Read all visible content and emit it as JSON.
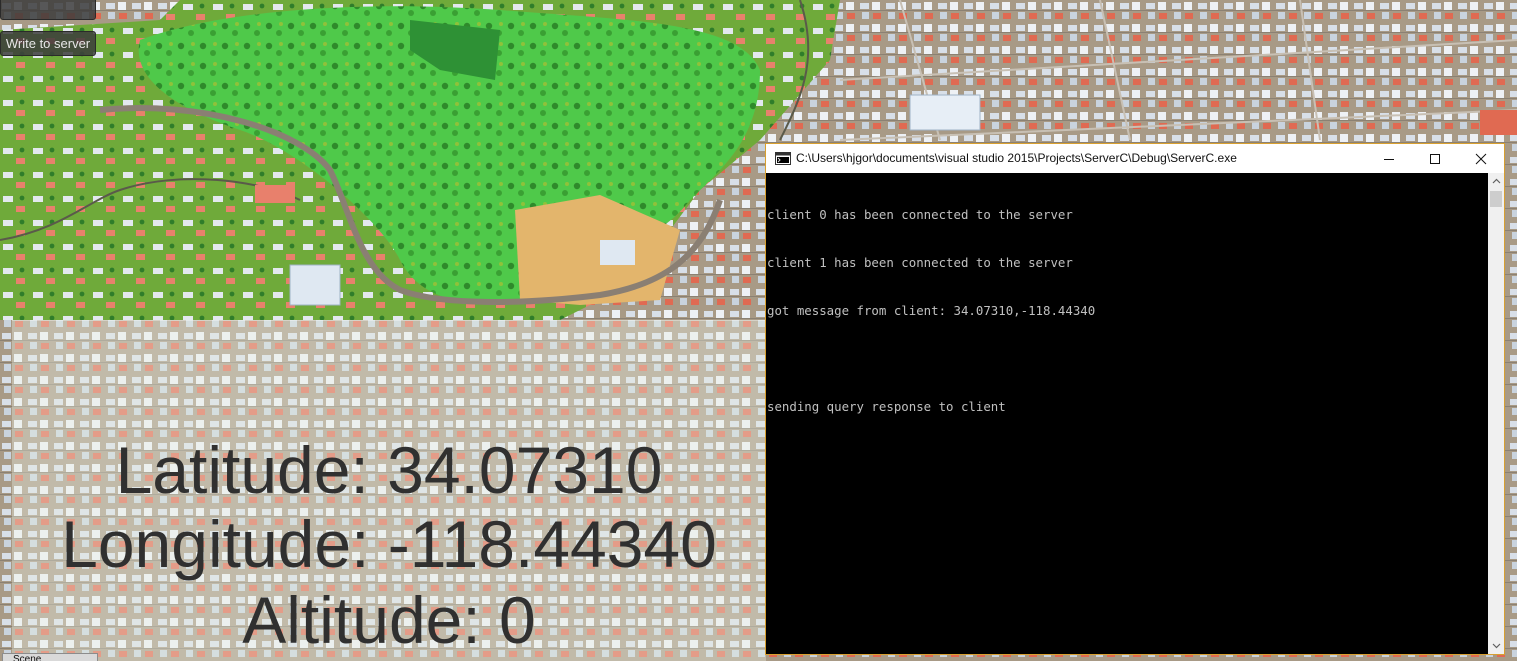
{
  "gui": {
    "top_button_label": "",
    "write_button_label": "Write to server"
  },
  "coords": {
    "latitude_label": "Latitude:",
    "latitude_value": "34.07310",
    "longitude_label": "Longitude:",
    "longitude_value": "-118.44340",
    "altitude_label": "Altitude:",
    "altitude_value": "0"
  },
  "bottom_tab": {
    "label": "Scene"
  },
  "console": {
    "title": "C:\\Users\\hjgor\\documents\\visual studio 2015\\Projects\\ServerC\\Debug\\ServerC.exe",
    "icons": {
      "app": "console-app-icon",
      "minimize": "minimize-icon",
      "maximize": "maximize-icon",
      "close": "close-icon"
    },
    "lines": [
      "client 0 has been connected to the server",
      "client 1 has been connected to the server",
      "got message from client: 34.07310,-118.44340",
      "",
      "sending query response to client"
    ]
  },
  "colors": {
    "console_bg": "#000000",
    "console_text": "#c0c0c0",
    "window_border": "#d8a030",
    "coord_text": "#303030"
  }
}
